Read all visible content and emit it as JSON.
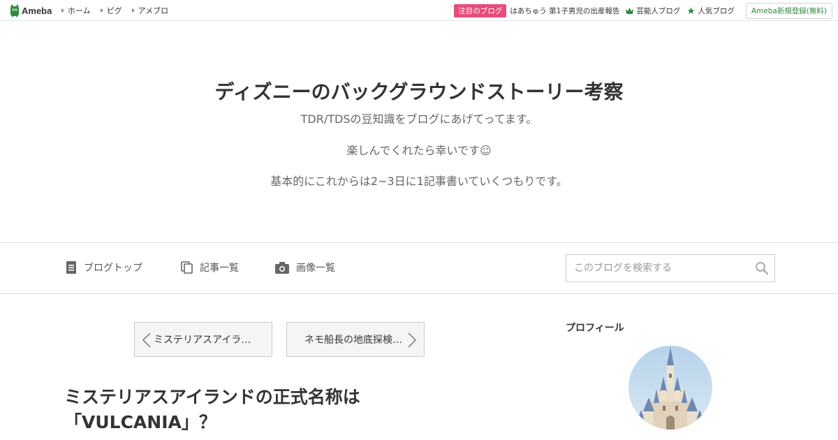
{
  "topbar": {
    "logo_text": "Ameba",
    "nav": [
      "ホーム",
      "ピグ",
      "アメブロ"
    ],
    "featured_badge": "注目のブログ",
    "featured_text": "はあちゅう 第1子男児の出産報告",
    "celebrity_link": "芸能人ブログ",
    "popular_link": "人気ブログ",
    "register_button": "Ameba新規登録(無料)",
    "colors": {
      "badge": "#e74c7a",
      "brand_green": "#2d8c3c"
    }
  },
  "header": {
    "title": "ディズニーのバックグラウンドストーリー考察",
    "desc": [
      "TDR/TDSの豆知識をブログにあげてってます。",
      "楽しんでくれたら幸いです☺",
      "基本的にこれからは2~3日に1記事書いていくつもりです。"
    ]
  },
  "navbar": {
    "items": [
      {
        "label": "ブログトップ",
        "icon": "document-icon"
      },
      {
        "label": "記事一覧",
        "icon": "copy-icon"
      },
      {
        "label": "画像一覧",
        "icon": "camera-icon"
      }
    ],
    "search_placeholder": "このブログを検索する"
  },
  "pager": {
    "prev": "ミステリアスアイラ…",
    "next": "ネモ船長の地底探検…"
  },
  "entry": {
    "title_line1": "ミステリアスアイランドの正式名称は",
    "title_line2": "「VULCANIA」？"
  },
  "sidebar": {
    "profile_heading": "プロフィール"
  }
}
